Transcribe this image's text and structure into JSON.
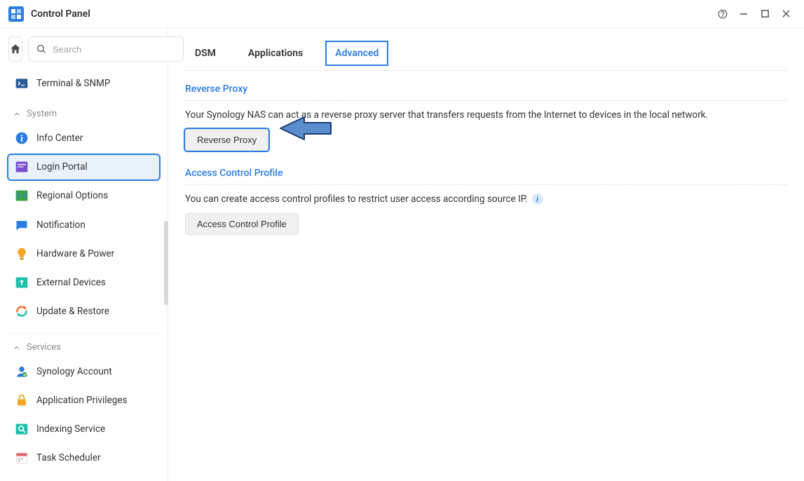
{
  "window": {
    "title": "Control Panel"
  },
  "sidebar": {
    "search_placeholder": "Search",
    "top_item": {
      "label": "Terminal & SNMP",
      "icon": "terminal-icon",
      "icon_color": "#2b5a98"
    },
    "groups": [
      {
        "name": "System",
        "items": [
          {
            "label": "Info Center",
            "icon": "info-icon",
            "icon_color": "#2b7de1"
          },
          {
            "label": "Login Portal",
            "icon": "portal-icon",
            "icon_color": "#7b4ed1",
            "selected": true
          },
          {
            "label": "Regional Options",
            "icon": "globe-icon",
            "icon_color": "#3aa24a"
          },
          {
            "label": "Notification",
            "icon": "message-icon",
            "icon_color": "#2b7de1"
          },
          {
            "label": "Hardware & Power",
            "icon": "bulb-icon",
            "icon_color": "#f5a623"
          },
          {
            "label": "External Devices",
            "icon": "upload-icon",
            "icon_color": "#1fbfa9"
          },
          {
            "label": "Update & Restore",
            "icon": "refresh-icon",
            "icon_color": "#f56a2b"
          }
        ]
      },
      {
        "name": "Services",
        "items": [
          {
            "label": "Synology Account",
            "icon": "person-icon",
            "icon_color": "#2b7de1"
          },
          {
            "label": "Application Privileges",
            "icon": "lock-icon",
            "icon_color": "#f5a623"
          },
          {
            "label": "Indexing Service",
            "icon": "search-service-icon",
            "icon_color": "#1fbfa9"
          },
          {
            "label": "Task Scheduler",
            "icon": "calendar-icon",
            "icon_color": "#e06666"
          }
        ]
      }
    ]
  },
  "tabs": [
    {
      "label": "DSM",
      "active": false
    },
    {
      "label": "Applications",
      "active": false
    },
    {
      "label": "Advanced",
      "active": true
    }
  ],
  "sections": {
    "reverse_proxy": {
      "title": "Reverse Proxy",
      "description": "Your Synology NAS can act as a reverse proxy server that transfers requests from the Internet to devices in the local network.",
      "button_label": "Reverse Proxy"
    },
    "access_control": {
      "title": "Access Control Profile",
      "description": "You can create access control profiles to restrict user access according source IP.",
      "button_label": "Access Control Profile"
    }
  },
  "colors": {
    "accent": "#2b7de1"
  }
}
